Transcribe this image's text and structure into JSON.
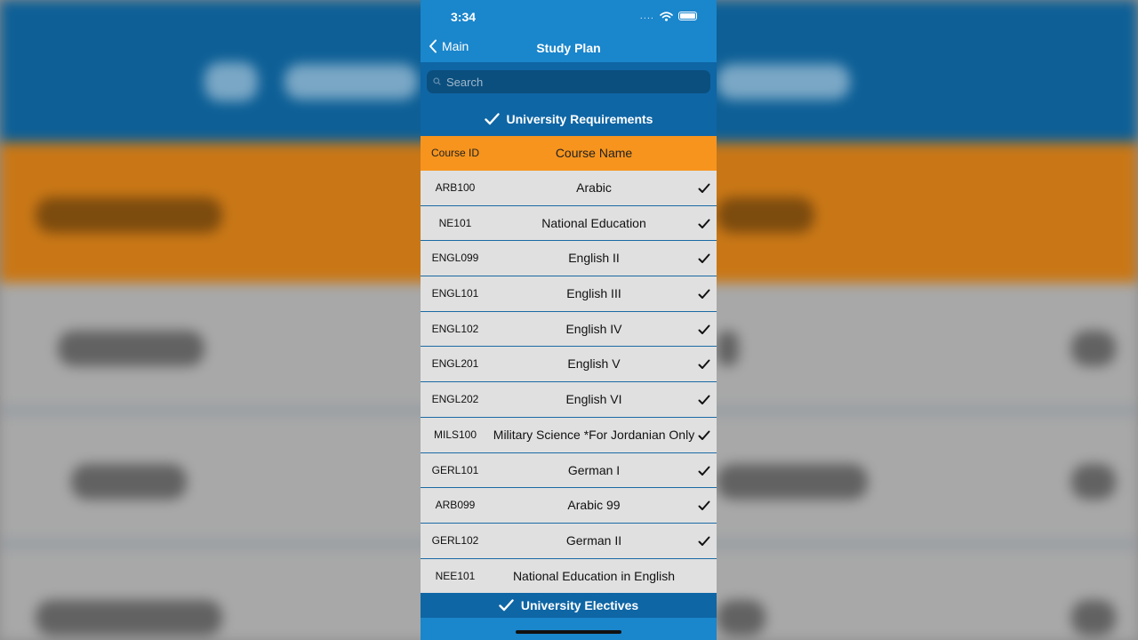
{
  "status_bar": {
    "time": "3:34",
    "signal": "...."
  },
  "nav": {
    "back_label": "Main",
    "title": "Study Plan"
  },
  "search": {
    "placeholder": "Search",
    "value": ""
  },
  "sections": [
    {
      "title": "University Requirements"
    },
    {
      "title": "University Electives"
    }
  ],
  "table": {
    "header_id": "Course ID",
    "header_name": "Course Name",
    "rows": [
      {
        "id": "ARB100",
        "name": "Arabic",
        "checked": true
      },
      {
        "id": "NE101",
        "name": "National Education",
        "checked": true
      },
      {
        "id": "ENGL099",
        "name": "English II",
        "checked": true
      },
      {
        "id": "ENGL101",
        "name": "English III",
        "checked": true
      },
      {
        "id": "ENGL102",
        "name": "English IV",
        "checked": true
      },
      {
        "id": "ENGL201",
        "name": "English V",
        "checked": true
      },
      {
        "id": "ENGL202",
        "name": "English VI",
        "checked": true
      },
      {
        "id": "MILS100",
        "name": "Military Science *For Jordanian Only",
        "checked": true
      },
      {
        "id": "GERL101",
        "name": "German I",
        "checked": true
      },
      {
        "id": "ARB099",
        "name": "Arabic 99",
        "checked": true
      },
      {
        "id": "GERL102",
        "name": "German II",
        "checked": true
      },
      {
        "id": "NEE101",
        "name": "National Education in English",
        "checked": false
      }
    ]
  },
  "colors": {
    "nav_blue": "#1a86cc",
    "section_blue": "#0f66a5",
    "header_orange": "#f7941d",
    "row_gray": "#e0e0e0"
  }
}
